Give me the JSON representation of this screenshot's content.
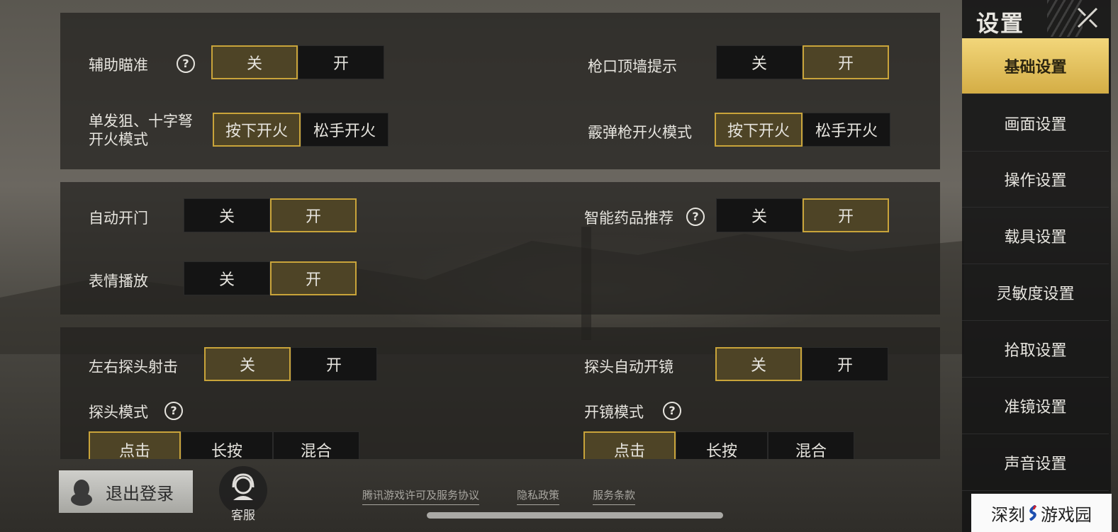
{
  "sidebar": {
    "title": "设置",
    "items": [
      {
        "label": "基础设置",
        "active": true
      },
      {
        "label": "画面设置",
        "active": false
      },
      {
        "label": "操作设置",
        "active": false
      },
      {
        "label": "载具设置",
        "active": false
      },
      {
        "label": "灵敏度设置",
        "active": false
      },
      {
        "label": "拾取设置",
        "active": false
      },
      {
        "label": "准镜设置",
        "active": false
      },
      {
        "label": "声音设置",
        "active": false
      }
    ]
  },
  "panel1": {
    "aim_assist": {
      "label": "辅助瞄准",
      "options": [
        "关",
        "开"
      ],
      "selected": "关"
    },
    "muzzle_wall": {
      "label": "枪口顶墙提示",
      "options": [
        "关",
        "开"
      ],
      "selected": "开"
    },
    "sniper_fire": {
      "label_line1": "单发狙、十字弩",
      "label_line2": "开火模式",
      "options": [
        "按下开火",
        "松手开火"
      ],
      "selected": "按下开火"
    },
    "shotgun_fire": {
      "label": "霰弹枪开火模式",
      "options": [
        "按下开火",
        "松手开火"
      ],
      "selected": "按下开火"
    }
  },
  "panel2": {
    "auto_door": {
      "label": "自动开门",
      "options": [
        "关",
        "开"
      ],
      "selected": "开"
    },
    "smart_meds": {
      "label": "智能药品推荐",
      "options": [
        "关",
        "开"
      ],
      "selected": "开"
    },
    "emote": {
      "label": "表情播放",
      "options": [
        "关",
        "开"
      ],
      "selected": "开"
    }
  },
  "panel3": {
    "peek_fire": {
      "label": "左右探头射击",
      "options": [
        "关",
        "开"
      ],
      "selected": "关"
    },
    "peek_scope": {
      "label": "探头自动开镜",
      "options": [
        "关",
        "开"
      ],
      "selected": "关"
    },
    "peek_mode": {
      "label": "探头模式",
      "options": [
        "点击",
        "长按",
        "混合"
      ],
      "selected": "点击"
    },
    "scope_mode": {
      "label": "开镜模式",
      "options": [
        "点击",
        "长按",
        "混合"
      ],
      "selected": "点击"
    }
  },
  "footer": {
    "logout": "退出登录",
    "service": "客服",
    "links": [
      "腾讯游戏许可及服务协议",
      "隐私政策",
      "服务条款"
    ]
  },
  "watermark": {
    "left": "深刻",
    "right": "游戏园"
  },
  "colors": {
    "accent": "#c9a43a",
    "selected_bg": "#4e4426",
    "active_tab": "#e6c25d"
  }
}
